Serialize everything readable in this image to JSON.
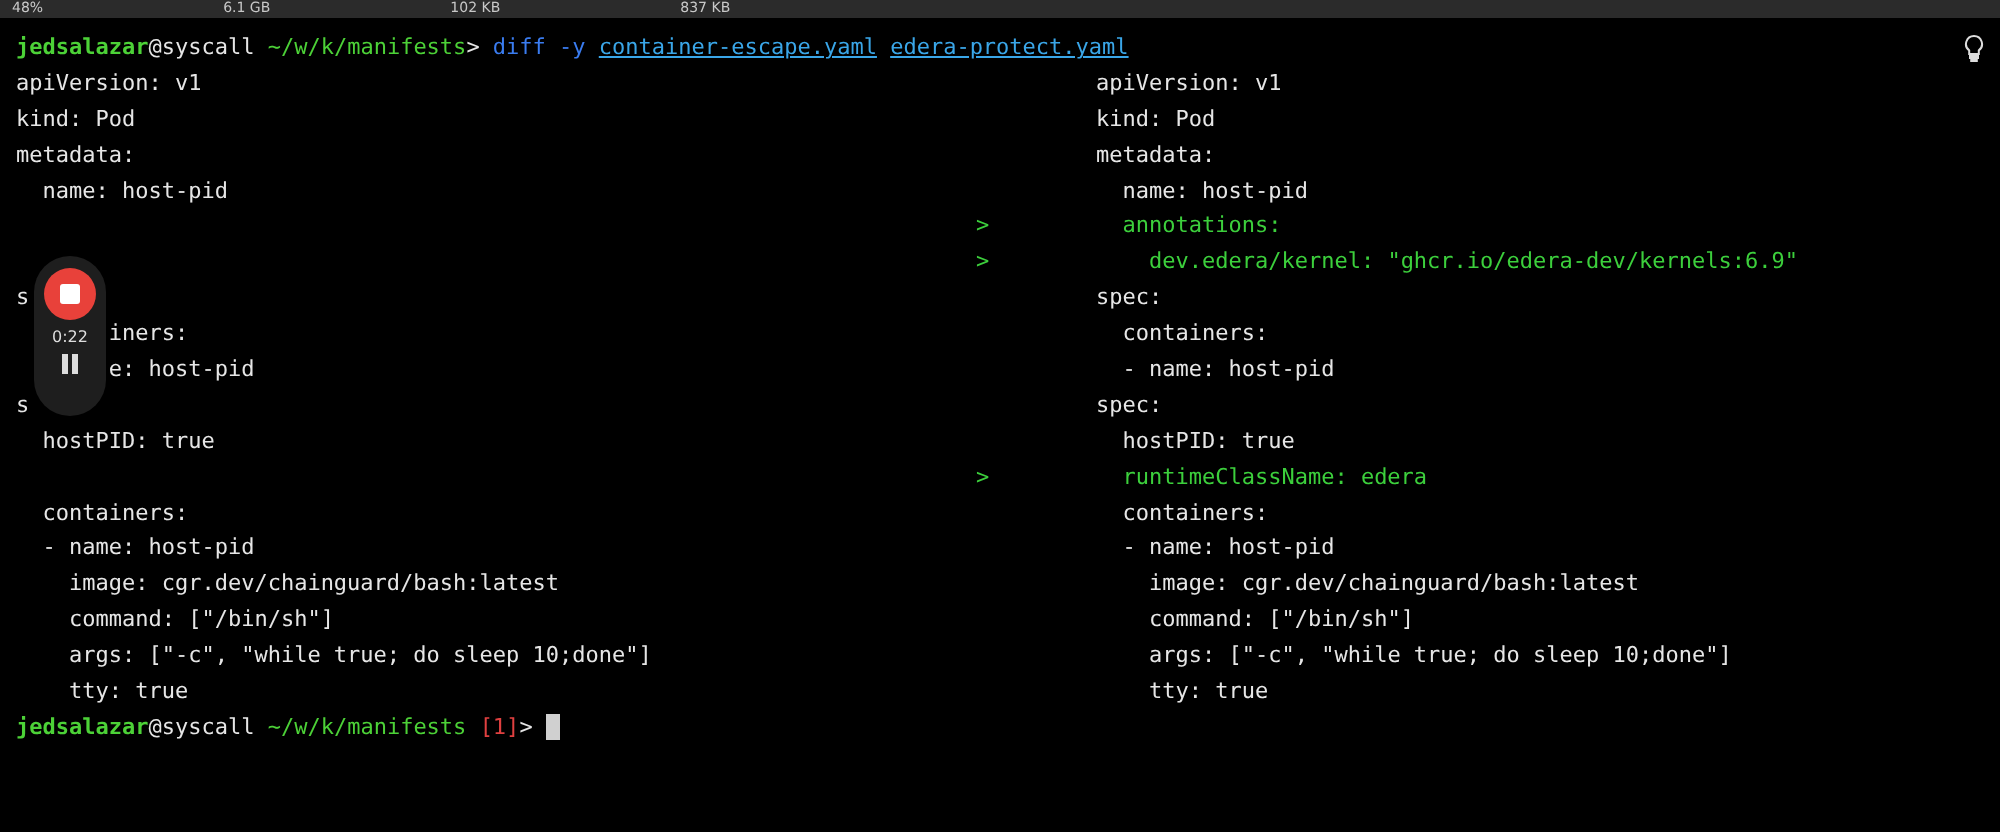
{
  "status_bar": [
    {
      "text": "48%"
    },
    {
      "text": "6.1 GB"
    },
    {
      "text": "102 KB"
    },
    {
      "text": "837 KB"
    }
  ],
  "command_line": {
    "prompt": {
      "user": "jedsalazar",
      "host": "@syscall",
      "path": " ~/w/k/manifests",
      "symbol": ">"
    },
    "command": "diff -y",
    "files": [
      "container-escape.yaml",
      "edera-protect.yaml"
    ]
  },
  "diff_rows": [
    {
      "left": "apiVersion: v1",
      "right": "apiVersion: v1",
      "added": false
    },
    {
      "left": "kind: Pod",
      "right": "kind: Pod",
      "added": false
    },
    {
      "left": "metadata:",
      "right": "metadata:",
      "added": false
    },
    {
      "left": "  name: host-pid",
      "right": "  name: host-pid",
      "added": false
    },
    {
      "marker": ">",
      "right": "  annotations:",
      "added": true
    },
    {
      "marker": ">",
      "right": "    dev.edera/kernel: \"ghcr.io/edera-dev/kernels:6.9\"",
      "added": true
    },
    {
      "left": "s",
      "right": "spec:",
      "added": false
    },
    {
      "left": "       iners:",
      "right": "  containers:",
      "added": false
    },
    {
      "left": "       e: host-pid",
      "right": "  - name: host-pid",
      "added": false
    },
    {
      "left": "s",
      "right": "spec:",
      "added": false
    },
    {
      "left": "  hostPID: true",
      "right": "  hostPID: true",
      "added": false
    },
    {
      "marker": ">",
      "right": "  runtimeClassName: edera",
      "added": true
    },
    {
      "left": "  containers:",
      "right": "  containers:",
      "added": false
    },
    {
      "left": "  - name: host-pid",
      "right": "  - name: host-pid",
      "added": false
    },
    {
      "left": "    image: cgr.dev/chainguard/bash:latest",
      "right": "    image: cgr.dev/chainguard/bash:latest",
      "added": false
    },
    {
      "left": "    command: [\"/bin/sh\"]",
      "right": "    command: [\"/bin/sh\"]",
      "added": false
    },
    {
      "left": "    args: [\"-c\", \"while true; do sleep 10;done\"]",
      "right": "    args: [\"-c\", \"while true; do sleep 10;done\"]",
      "added": false
    },
    {
      "left": "    tty: true",
      "right": "    tty: true",
      "added": false
    }
  ],
  "final_prompt": {
    "user": "jedsalazar",
    "host": "@syscall",
    "path": " ~/w/k/manifests ",
    "exit_code": "[1]",
    "symbol": ">"
  },
  "recording": {
    "time": "0:22"
  }
}
